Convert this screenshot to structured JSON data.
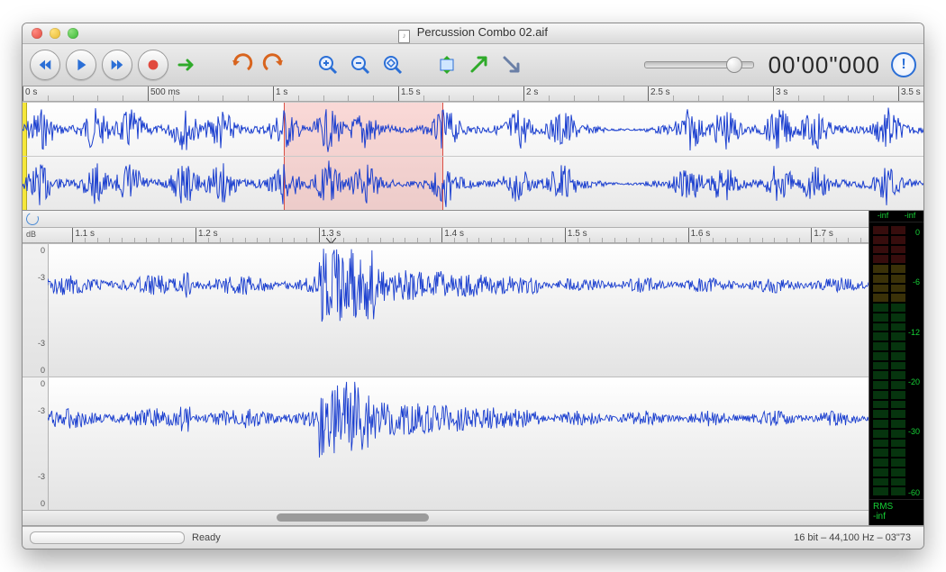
{
  "window": {
    "title": "Percussion Combo 02.aif"
  },
  "toolbar": {
    "slider_value": 0.75,
    "timecode": "00'00\"000"
  },
  "overview": {
    "ruler": {
      "unit_header": "0 s",
      "majors": [
        {
          "pos": 0.0,
          "label": "0 s"
        },
        {
          "pos": 0.139,
          "label": "500 ms"
        },
        {
          "pos": 0.278,
          "label": "1 s"
        },
        {
          "pos": 0.417,
          "label": "1.5 s"
        },
        {
          "pos": 0.556,
          "label": "2 s"
        },
        {
          "pos": 0.694,
          "label": "2.5 s"
        },
        {
          "pos": 0.833,
          "label": "3 s"
        },
        {
          "pos": 0.972,
          "label": "3.5 s"
        }
      ]
    },
    "selection": {
      "start": 0.29,
      "end": 0.465
    }
  },
  "detail": {
    "db_header": "dB",
    "ruler": {
      "majors": [
        {
          "pos": 0.03,
          "label": "1.1 s"
        },
        {
          "pos": 0.18,
          "label": "1.2 s"
        },
        {
          "pos": 0.33,
          "label": "1.3 s"
        },
        {
          "pos": 0.48,
          "label": "1.4 s"
        },
        {
          "pos": 0.63,
          "label": "1.5 s"
        },
        {
          "pos": 0.78,
          "label": "1.6 s"
        },
        {
          "pos": 0.93,
          "label": "1.7 s"
        }
      ]
    },
    "db_scale": [
      "0",
      "-3",
      "-3",
      "0"
    ],
    "playhead": 0.345,
    "scroll": {
      "pos": 0.3,
      "size": 0.18
    }
  },
  "meter": {
    "peak_left": "-inf",
    "peak_right": "-inf",
    "rms_label": "RMS",
    "rms_value": "-inf",
    "scale": [
      {
        "pos": 0.02,
        "label": "0"
      },
      {
        "pos": 0.2,
        "label": "-6"
      },
      {
        "pos": 0.38,
        "label": "-12"
      },
      {
        "pos": 0.56,
        "label": "-20"
      },
      {
        "pos": 0.74,
        "label": "-30"
      },
      {
        "pos": 0.96,
        "label": "-60"
      }
    ]
  },
  "status": {
    "state": "Ready",
    "audio_info": "16 bit – 44,100 Hz – 03\"73"
  }
}
